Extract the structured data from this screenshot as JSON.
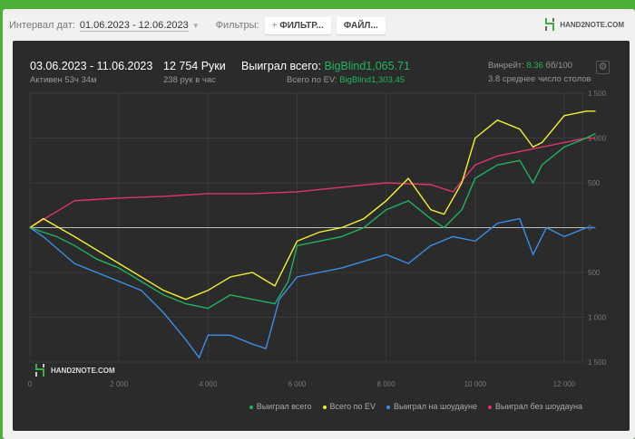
{
  "toolbar": {
    "interval_label": "Интервал дат:",
    "interval_value": "01.06.2023 - 12.06.2023",
    "filters_label": "Фильтры:",
    "filter_button": "ФИЛЬТР...",
    "files_button": "ФАЙЛ..."
  },
  "brand": {
    "logo_text": "HAND2NOTE.COM"
  },
  "summary": {
    "date_range": "03.06.2023 - 11.06.2023",
    "active": "Активен 53ч 34м",
    "hands": "12 754 Руки",
    "hands_per_hour": "238 рук в час",
    "won_label": "Выиграл всего:",
    "won_value": "BigBlind1,065.71",
    "ev_label": "Всего по EV:",
    "ev_value": "BigBlind1,303.45",
    "winrate_label": "Винрейт:",
    "winrate_value": "8.36",
    "winrate_unit": "бб/100",
    "tables": "3.8 среднее число столов"
  },
  "colors": {
    "accent": "#22b560",
    "won": "#1fb25f",
    "ev": "#f2f230",
    "showdown": "#3b8fe6",
    "nonshowdown": "#e0356a"
  },
  "chart_data": {
    "type": "line",
    "xlim": [
      0,
      12800
    ],
    "ylim": [
      -1500,
      1500
    ],
    "grid": true,
    "legend": "bottom-right",
    "x_ticks": [
      0,
      2000,
      4000,
      6000,
      8000,
      10000,
      12000
    ],
    "x_tick_labels": [
      "0",
      "2 000",
      "4 000",
      "6 000",
      "8 000",
      "10 000",
      "12 000"
    ],
    "y_ticks": [
      1500,
      1000,
      500,
      0,
      -500,
      -1000,
      -1500
    ],
    "y_tick_labels": [
      "1 500",
      "1 000",
      "500",
      "0",
      "500",
      "1 000",
      "1 500"
    ],
    "series": [
      {
        "name": "Выиграл всего",
        "color": "#1fb25f",
        "x": [
          0,
          300,
          600,
          1000,
          1500,
          2000,
          2500,
          3000,
          3500,
          4000,
          4500,
          5000,
          5500,
          5800,
          6000,
          6500,
          7000,
          7500,
          8000,
          8500,
          9000,
          9300,
          9700,
          10000,
          10500,
          11000,
          11300,
          11500,
          12000,
          12500,
          12700
        ],
        "y": [
          0,
          -50,
          -100,
          -200,
          -350,
          -450,
          -600,
          -750,
          -850,
          -900,
          -750,
          -800,
          -850,
          -600,
          -200,
          -150,
          -100,
          0,
          200,
          300,
          100,
          0,
          200,
          550,
          700,
          750,
          500,
          700,
          900,
          1000,
          1050
        ]
      },
      {
        "name": "Всего по EV",
        "color": "#f2f230",
        "x": [
          0,
          300,
          1000,
          2000,
          3000,
          3500,
          4000,
          4500,
          5000,
          5500,
          6000,
          6500,
          7000,
          7500,
          8000,
          8500,
          9000,
          9300,
          9700,
          10000,
          10500,
          11000,
          11300,
          11500,
          12000,
          12500,
          12700
        ],
        "y": [
          0,
          100,
          -100,
          -400,
          -700,
          -800,
          -700,
          -550,
          -500,
          -650,
          -150,
          -50,
          0,
          100,
          300,
          550,
          200,
          150,
          500,
          1000,
          1200,
          1100,
          900,
          950,
          1250,
          1300,
          1300
        ]
      },
      {
        "name": "Выиграл на шоудауне",
        "color": "#3b8fe6",
        "x": [
          0,
          300,
          1000,
          2000,
          2500,
          3000,
          3500,
          3800,
          4000,
          4500,
          5000,
          5300,
          5600,
          6000,
          6500,
          7000,
          8000,
          8500,
          9000,
          9500,
          10000,
          10500,
          11000,
          11300,
          11600,
          12000,
          12500,
          12700
        ],
        "y": [
          0,
          -100,
          -400,
          -600,
          -700,
          -950,
          -1250,
          -1450,
          -1200,
          -1200,
          -1300,
          -1350,
          -800,
          -550,
          -500,
          -450,
          -300,
          -400,
          -200,
          -100,
          -150,
          50,
          100,
          -300,
          0,
          -100,
          0,
          0
        ]
      },
      {
        "name": "Выиграл без шоудауна",
        "color": "#e0356a",
        "x": [
          0,
          500,
          1000,
          2000,
          3000,
          4000,
          5000,
          6000,
          7000,
          8000,
          9000,
          9500,
          10000,
          10500,
          11000,
          11500,
          12000,
          12500,
          12700
        ],
        "y": [
          0,
          150,
          300,
          330,
          350,
          380,
          380,
          400,
          450,
          500,
          480,
          400,
          700,
          800,
          850,
          900,
          950,
          1000,
          1000
        ]
      }
    ]
  }
}
